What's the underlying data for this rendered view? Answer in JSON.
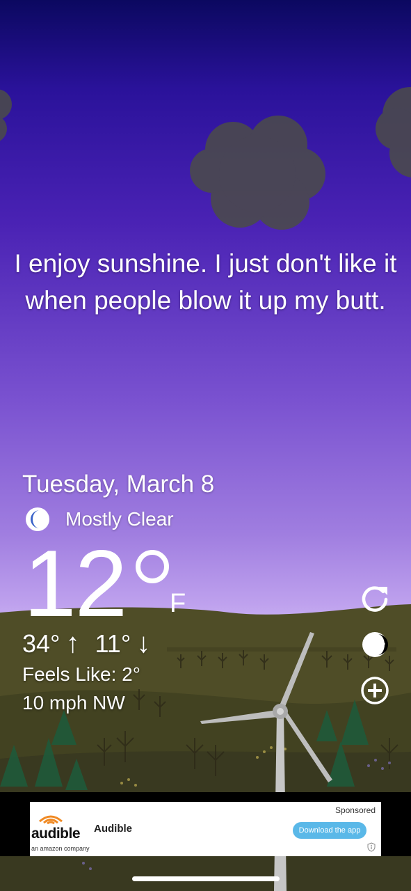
{
  "quote": "I enjoy sunshine. I just don't like it when people blow it up my butt.",
  "date": "Tuesday, March 8",
  "condition": {
    "icon": "moon-icon",
    "text": "Mostly Clear"
  },
  "temperature": {
    "value": "12",
    "unit": "F"
  },
  "high": "34°",
  "low": "11°",
  "arrows": {
    "up": "↑",
    "down": "↓"
  },
  "feels_like": "Feels Like: 2°",
  "wind": "10 mph NW",
  "side_buttons": [
    "refresh-icon",
    "moon-phase-icon",
    "add-icon"
  ],
  "ad": {
    "sponsored": "Sponsored",
    "brand": "audible",
    "tagline": "an amazon company",
    "name": "Audible",
    "cta": "Download the app"
  },
  "colors": {
    "sky_top": "#0b0860",
    "sky_bottom": "#c9b2f2",
    "hill": "#4a4a26",
    "cta": "#5ab8e8"
  }
}
